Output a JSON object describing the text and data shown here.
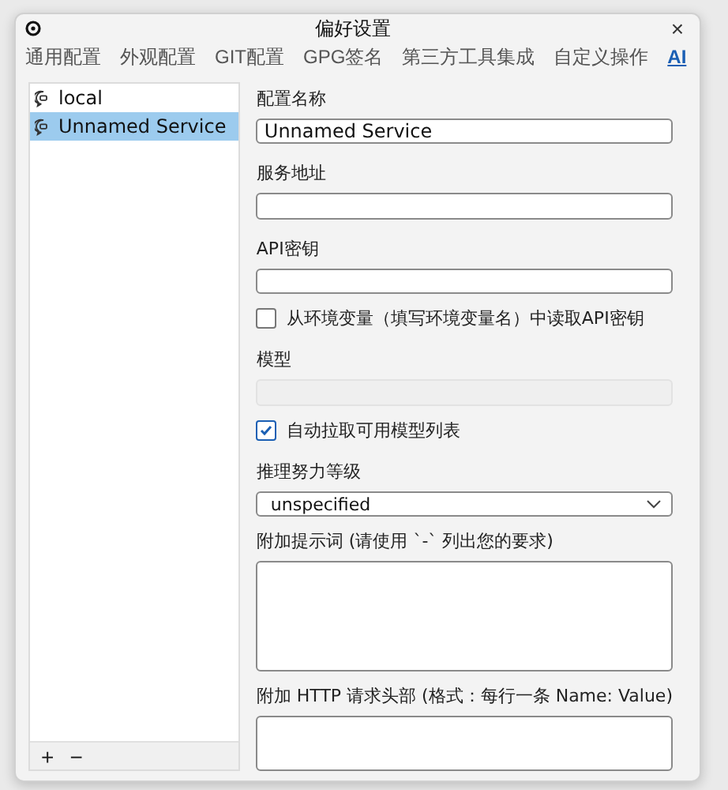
{
  "window": {
    "title": "偏好设置",
    "close": "×"
  },
  "tabs": [
    {
      "label": "通用配置",
      "selected": false
    },
    {
      "label": "外观配置",
      "selected": false
    },
    {
      "label": "GIT配置",
      "selected": false
    },
    {
      "label": "GPG签名",
      "selected": false
    },
    {
      "label": "第三方工具集成",
      "selected": false
    },
    {
      "label": "自定义操作",
      "selected": false
    },
    {
      "label": "AI",
      "selected": true
    }
  ],
  "services": [
    {
      "name": "local",
      "selected": false
    },
    {
      "name": "Unnamed Service",
      "selected": true
    }
  ],
  "list_buttons": [
    "+",
    "−"
  ],
  "form": [
    {
      "kind": "text",
      "label": "配置名称",
      "value": "Unnamed Service"
    },
    {
      "kind": "text",
      "label": "服务地址"
    },
    {
      "kind": "text",
      "label": "API密钥"
    },
    {
      "kind": "check",
      "label": "从环境变量（填写环境变量名）中读取API密钥",
      "checked": false
    },
    {
      "kind": "text",
      "label": "模型",
      "disabled": true
    },
    {
      "kind": "check",
      "label": "自动拉取可用模型列表",
      "checked": true
    },
    {
      "kind": "select",
      "label": "推理努力等级",
      "value": "unspecified"
    },
    {
      "kind": "area",
      "label": "附加提示词 (请使用 `-` 列出您的要求)"
    },
    {
      "kind": "area",
      "label": "附加 HTTP 请求头部 (格式：每行一条 Name: Value)"
    }
  ]
}
